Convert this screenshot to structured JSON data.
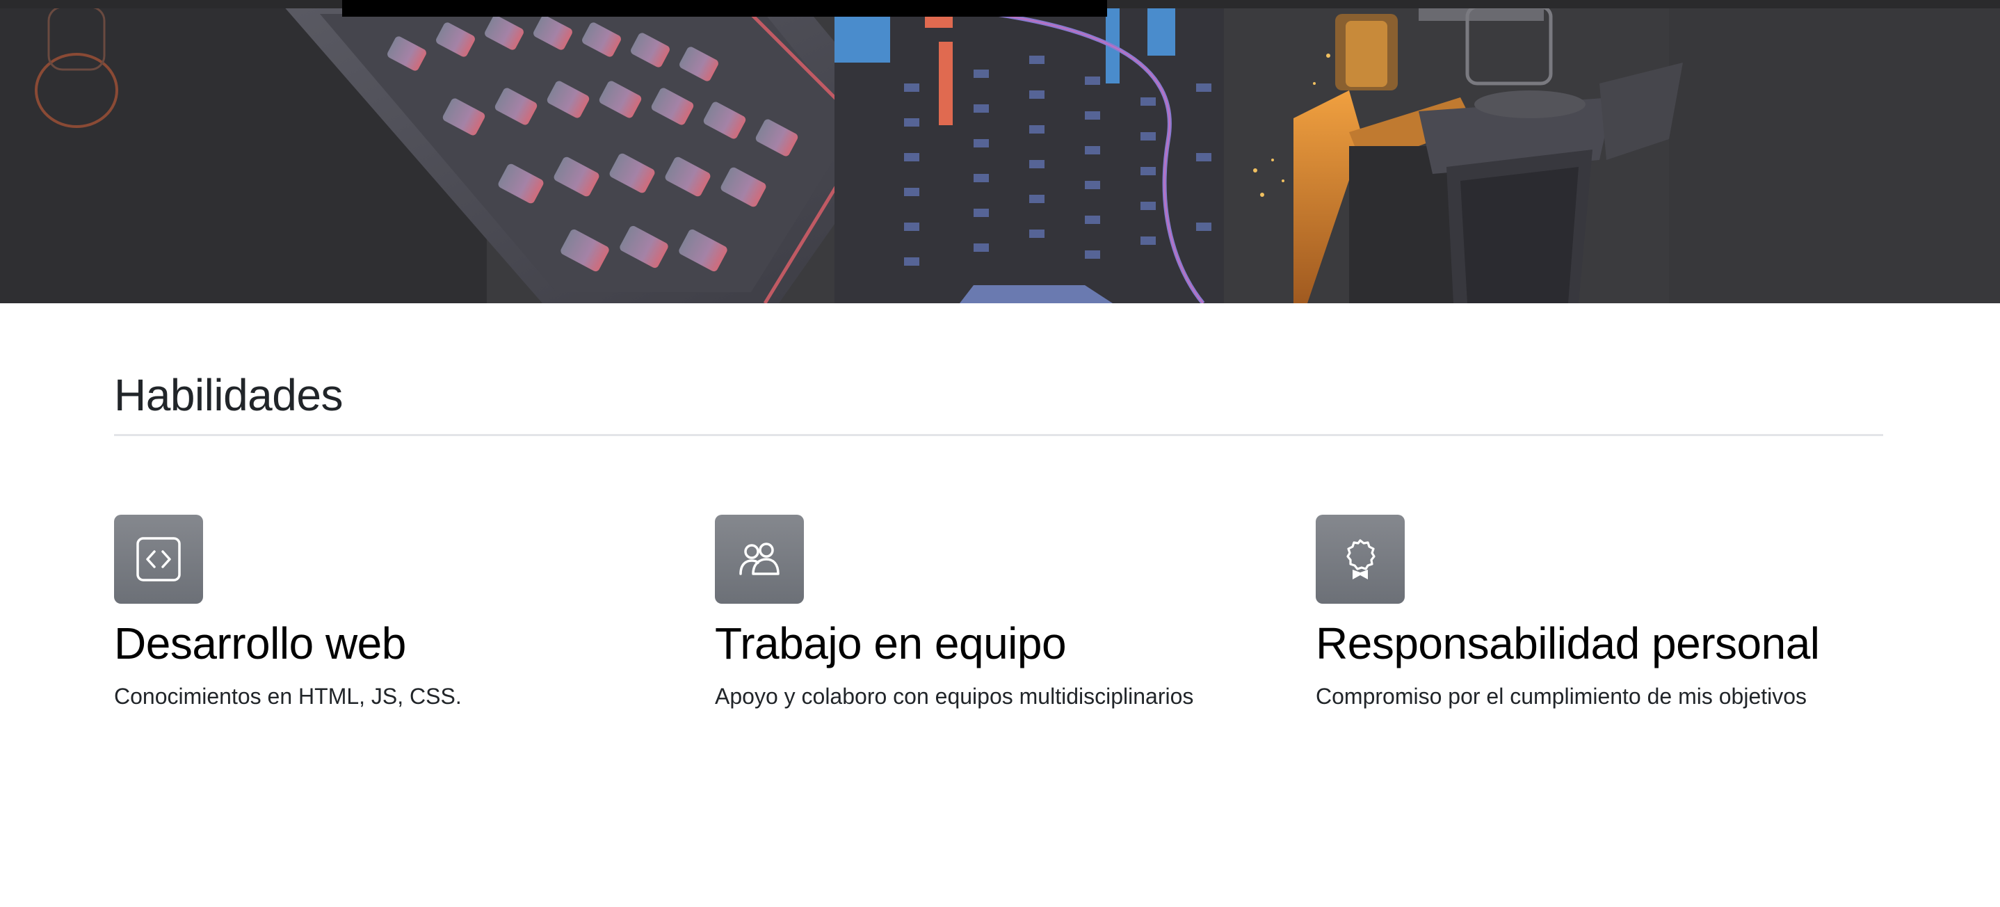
{
  "hero": {
    "image": "keyboard-city-illustration"
  },
  "skills_section": {
    "title": "Habilidades",
    "items": [
      {
        "icon": "code-icon",
        "title": "Desarrollo web",
        "text": "Conocimientos en HTML, JS, CSS."
      },
      {
        "icon": "people-icon",
        "title": "Trabajo en equipo",
        "text": "Apoyo y colaboro con equipos multidisciplinarios"
      },
      {
        "icon": "award-icon",
        "title": "Responsabilidad personal",
        "text": "Compromiso por el cumplimiento de mis objetivos"
      }
    ]
  },
  "colors": {
    "icon_background": "#6c7077",
    "text": "#212529",
    "divider": "#e3e5e8"
  }
}
